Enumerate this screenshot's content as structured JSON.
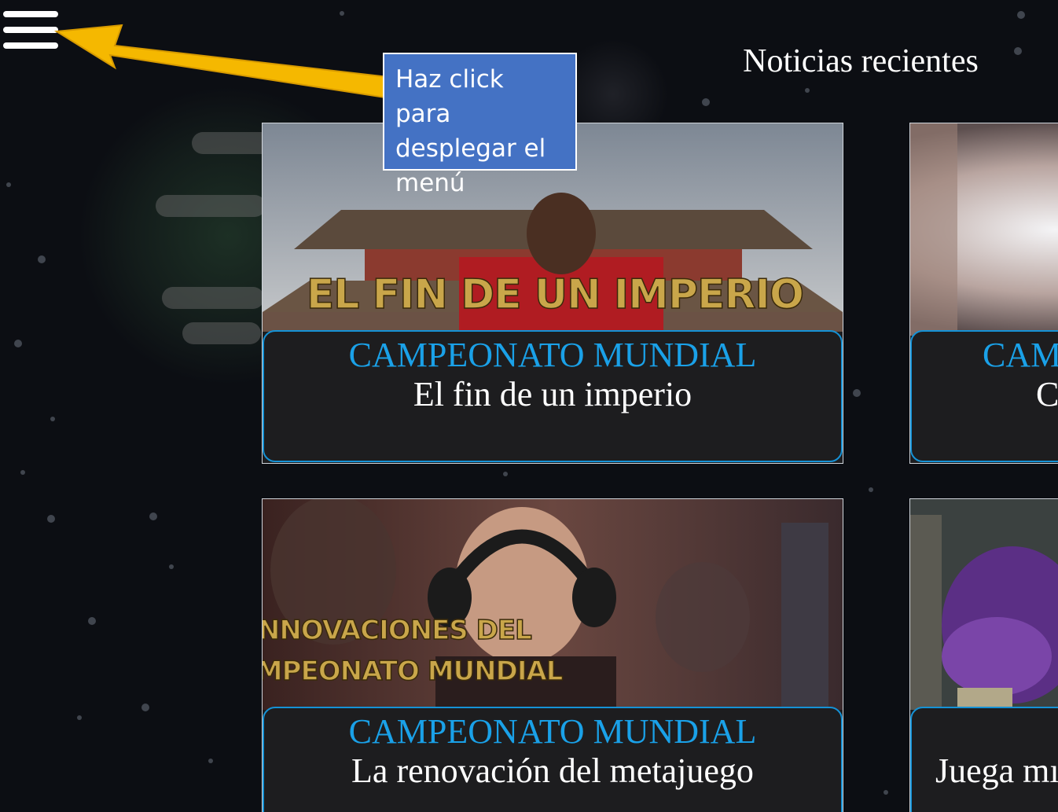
{
  "header": {
    "page_title": "Noticias recientes",
    "menu_icon": "hamburger-menu-icon"
  },
  "callout": {
    "text": "Haz click para desplegar el menú",
    "color": "#4472c4",
    "arrow_color": "#f5b800"
  },
  "news_cards": [
    {
      "image_overlay_text": "EL FIN DE UN IMPERIO",
      "category": "CAMPEONATO MUNDIAL",
      "headline": "El fin de un imperio"
    },
    {
      "image_overlay_text": "",
      "category": "CAM",
      "headline": "C"
    },
    {
      "image_overlay_text_line1": "INNOVACIONES DEL",
      "image_overlay_text_line2": "CAMPEONATO MUNDIAL",
      "category": "CAMPEONATO MUNDIAL",
      "headline": "La renovación del metajuego"
    },
    {
      "image_overlay_text": "",
      "category": "",
      "headline": "Juega mı"
    }
  ],
  "colors": {
    "background": "#0c0e13",
    "caption_border": "#1592d6",
    "category_text": "#1aa1e8"
  }
}
